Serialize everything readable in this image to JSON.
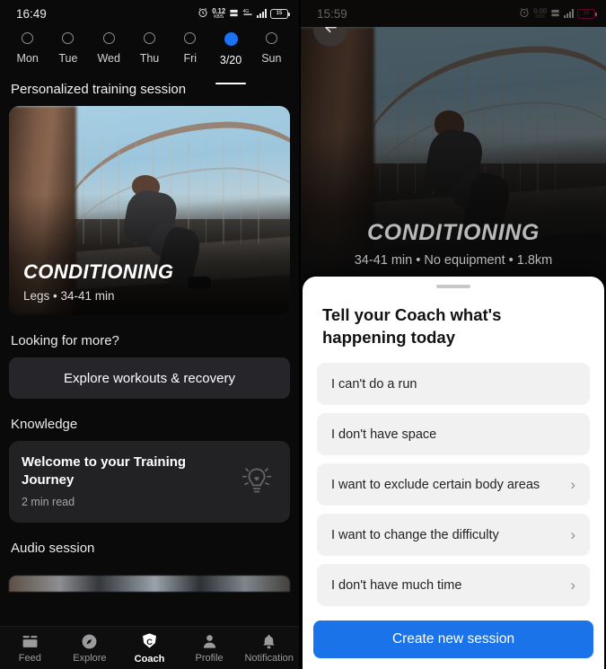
{
  "left": {
    "status_bar": {
      "time": "16:49",
      "net_rate_value": "0.12",
      "net_rate_unit": "KB/S",
      "battery_level": "15"
    },
    "days": [
      {
        "label": "Mon",
        "selected": false
      },
      {
        "label": "Tue",
        "selected": false
      },
      {
        "label": "Wed",
        "selected": false
      },
      {
        "label": "Thu",
        "selected": false
      },
      {
        "label": "Fri",
        "selected": false
      },
      {
        "label": "3/20",
        "selected": true
      },
      {
        "label": "Sun",
        "selected": false
      }
    ],
    "section_title": "Personalized training session",
    "hero": {
      "title": "CONDITIONING",
      "meta": "Legs  •  34-41 min"
    },
    "looking_for_more_label": "Looking for more?",
    "explore_button": "Explore workouts & recovery",
    "knowledge_label": "Knowledge",
    "knowledge_card": {
      "title": "Welcome to your Training Journey",
      "subtitle": "2 min read",
      "icon": "lightbulb-icon"
    },
    "audio_label": "Audio session",
    "tabs": [
      {
        "label": "Feed",
        "icon": "feed-icon",
        "active": false
      },
      {
        "label": "Explore",
        "icon": "compass-icon",
        "active": false
      },
      {
        "label": "Coach",
        "icon": "coach-badge-icon",
        "active": true
      },
      {
        "label": "Profile",
        "icon": "person-icon",
        "active": false
      },
      {
        "label": "Notification",
        "icon": "bell-icon",
        "active": false
      }
    ]
  },
  "right": {
    "status_bar": {
      "time": "15:59",
      "net_rate_value": "0.00",
      "net_rate_unit": "KB/S",
      "battery_level": "10"
    },
    "back_button": "back-arrow-icon",
    "hero": {
      "title": "CONDITIONING",
      "meta": "34-41 min  •  No equipment  •  1.8km"
    },
    "sheet": {
      "title": "Tell your Coach what's happening today",
      "options": [
        {
          "label": "I can't do a run",
          "chevron": false
        },
        {
          "label": "I don't have space",
          "chevron": false
        },
        {
          "label": "I want to exclude certain body areas",
          "chevron": true
        },
        {
          "label": "I want to change the difficulty",
          "chevron": true
        },
        {
          "label": "I don't have much time",
          "chevron": true
        }
      ],
      "primary_button": "Create new session"
    }
  },
  "colors": {
    "accent_blue": "#1a73e8",
    "day_dot_selected": "#1a73f5",
    "sheet_bg": "#ffffff",
    "option_bg": "#f1f1f2"
  }
}
